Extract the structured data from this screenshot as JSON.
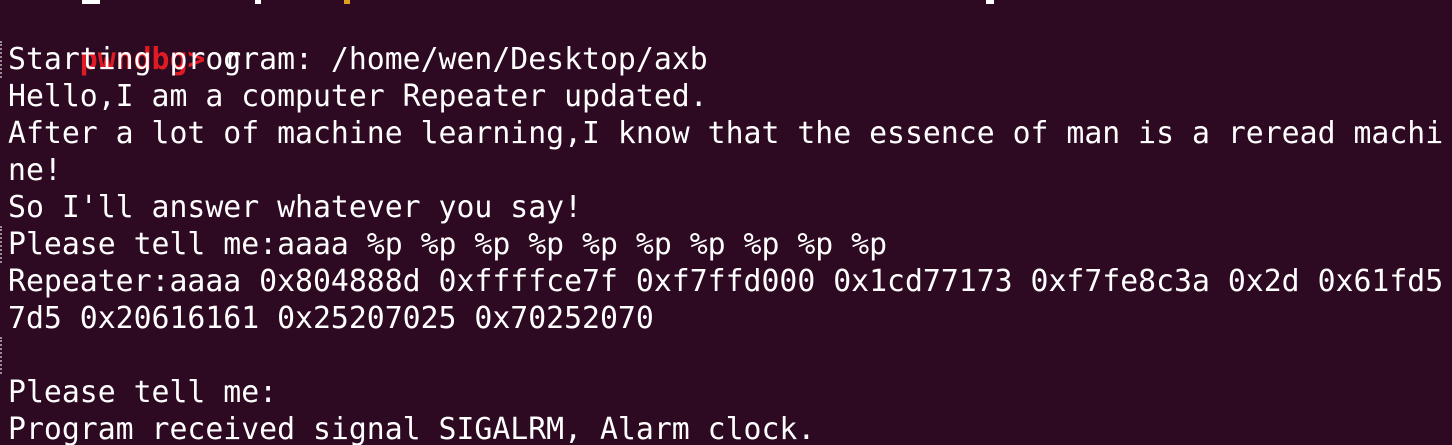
{
  "terminal": {
    "prompt": "pwndbg>",
    "command": "r",
    "lines": [
      "Starting program: /home/wen/Desktop/axb",
      "Hello,I am a computer Repeater updated.",
      "After a lot of machine learning,I know that the essence of man is a reread machi",
      "ne!",
      "So I'll answer whatever you say!",
      "Please tell me:aaaa %p %p %p %p %p %p %p %p %p %p",
      "Repeater:aaaa 0x804888d 0xffffce7f 0xf7ffd000 0x1cd77173 0xf7fe8c3a 0x2d 0x61fd5",
      "7d5 0x20616161 0x25207025 0x70252070",
      "",
      "Please tell me:",
      "Program received signal SIGALRM, Alarm clock."
    ]
  },
  "colors": {
    "background": "#2d0922",
    "text": "#ffffff",
    "prompt": "#e01b24"
  }
}
